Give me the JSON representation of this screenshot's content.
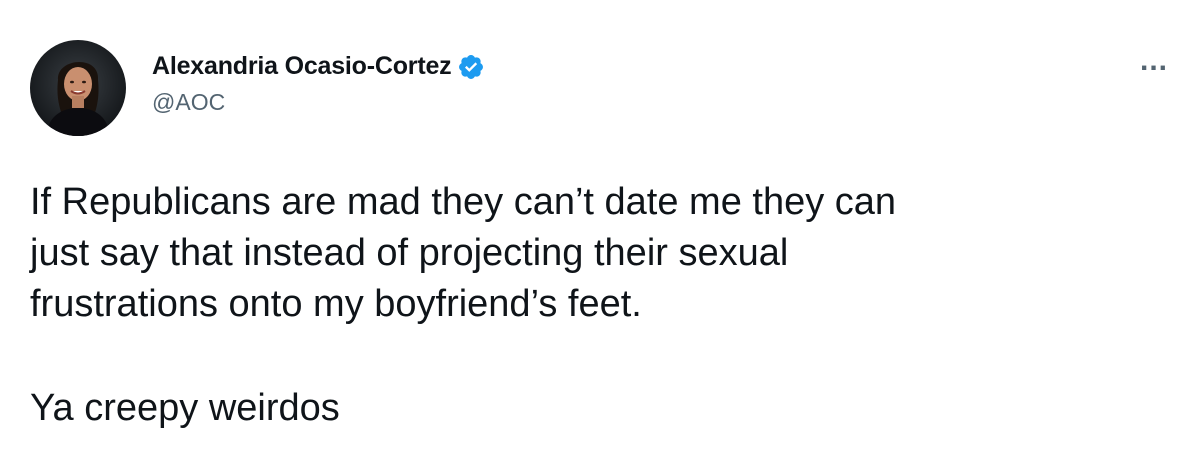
{
  "author": {
    "display_name": "Alexandria Ocasio-Cortez",
    "handle": "@AOC",
    "verified": true,
    "avatar_icon": "profile-photo",
    "verified_icon": "verified-badge-icon",
    "verified_color": "#1d9bf0"
  },
  "menu": {
    "more_label": "..."
  },
  "tweet": {
    "lines": [
      "If Republicans are mad they can’t date me they can",
      "just say that instead of projecting their sexual",
      "frustrations onto my boyfriend’s feet."
    ],
    "closing": "Ya creepy weirdos"
  },
  "colors": {
    "text_primary": "#0f1419",
    "text_secondary": "#536471",
    "background": "#ffffff"
  }
}
